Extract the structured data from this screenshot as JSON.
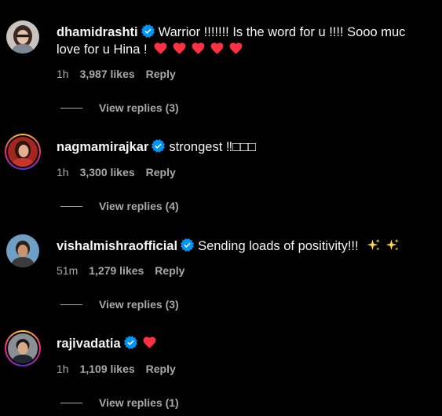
{
  "colors": {
    "background": "#000000",
    "text": "#f5f5f5",
    "muted": "#a8a8a8",
    "verified": "#0095f6",
    "heart": "#ff3040"
  },
  "comments": [
    {
      "username": "dhamidrashti",
      "text": "Warrior !!!!!!! Is the word for u !!!! Sooo muc love for u Hina !",
      "text_line1": "Warrior !!!!!!! Is the word for u !!!! Sooo muc",
      "text_line2": "love for u Hina !",
      "emoji": [
        "red-heart",
        "red-heart",
        "red-heart",
        "red-heart",
        "red-heart"
      ],
      "time": "1h",
      "likes": "3,987 likes",
      "reply": "Reply",
      "view_replies": "View replies (3)",
      "avatar_icon": "profile-photo-icon"
    },
    {
      "username": "nagmamirajkar",
      "text": "strongest ‼□□□",
      "time": "1h",
      "likes": "3,300 likes",
      "reply": "Reply",
      "view_replies": "View replies (4)",
      "avatar_icon": "profile-photo-icon"
    },
    {
      "username": "vishalmishraofficial",
      "text": "Sending loads of positivity!!!",
      "emoji": [
        "sparkles",
        "sparkles"
      ],
      "time": "51m",
      "likes": "1,279 likes",
      "reply": "Reply",
      "view_replies": "View replies (3)",
      "avatar_icon": "profile-photo-icon"
    },
    {
      "username": "rajivadatia",
      "text": "",
      "emoji": [
        "red-heart"
      ],
      "time": "1h",
      "likes": "1,109 likes",
      "reply": "Reply",
      "view_replies": "View replies (1)",
      "avatar_icon": "profile-photo-icon"
    }
  ]
}
